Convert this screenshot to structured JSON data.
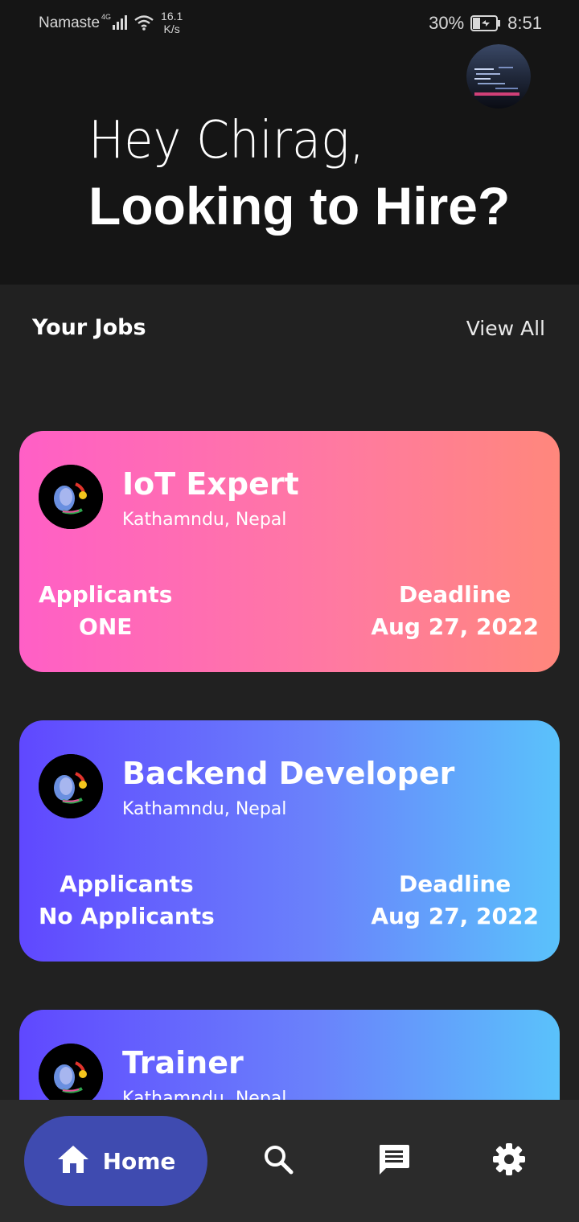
{
  "status_bar": {
    "carrier": "Namaste",
    "network_type": "4G",
    "speed_value": "16.1",
    "speed_unit": "K/s",
    "battery_percent": "30%",
    "time": "8:51"
  },
  "header": {
    "greeting": "Hey Chirag,",
    "headline": "Looking to Hire?"
  },
  "section": {
    "title": "Your Jobs",
    "view_all_label": "View All"
  },
  "jobs": [
    {
      "title": "IoT Expert",
      "location": "Kathamndu, Nepal",
      "applicants_label": "Applicants",
      "applicants_value": "ONE",
      "deadline_label": "Deadline",
      "deadline_value": "Aug 27, 2022"
    },
    {
      "title": "Backend Developer",
      "location": "Kathamndu, Nepal",
      "applicants_label": "Applicants",
      "applicants_value": "No Applicants",
      "deadline_label": "Deadline",
      "deadline_value": "Aug 27, 2022"
    },
    {
      "title": "Trainer",
      "location": "Kathamndu, Nepal"
    }
  ],
  "nav": {
    "home_label": "Home",
    "icons": [
      "home-icon",
      "search-icon",
      "chat-icon",
      "gear-icon"
    ]
  },
  "colors": {
    "background": "#212121",
    "header_bg": "#151515",
    "nav_bg": "#2b2b2b",
    "nav_active": "#3f4bb0",
    "card_pink_start": "#ff5fc6",
    "card_pink_end": "#ff877c",
    "card_blue_start": "#6048ff",
    "card_blue_end": "#5ac2fb"
  }
}
